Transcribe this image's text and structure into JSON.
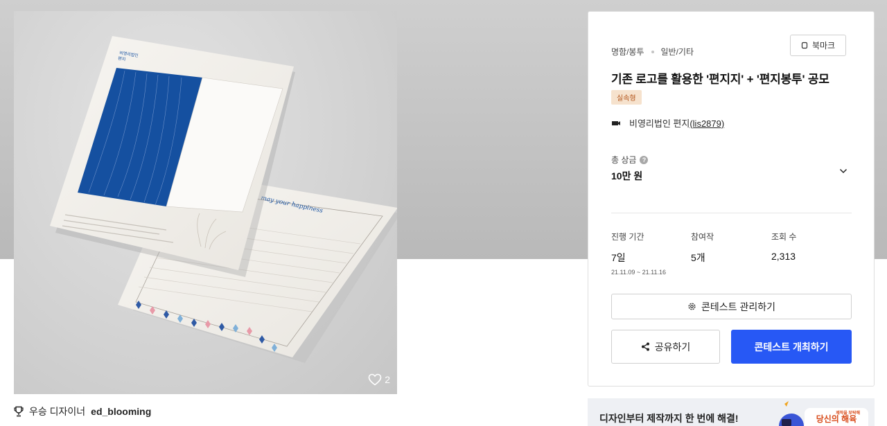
{
  "hero": {
    "like_count": "2",
    "letter_top_lines": [
      "비영리법인",
      "편지"
    ],
    "letter_script": "may your happiness"
  },
  "winner": {
    "prefix": "우승 디자이너",
    "name": "ed_blooming"
  },
  "panel": {
    "category": "명함/봉투",
    "subcategory": "일반/기타",
    "bookmark_label": "북마크",
    "title": "기존 로고를 활용한 '편지지' + '편지봉투' 공모",
    "badge": "실속형",
    "org_name": "비영리법인 편지",
    "org_handle": "(lis2879)",
    "prize_label": "총 상금",
    "prize_value": "10만 원",
    "stats": [
      {
        "label": "진행 기간",
        "value": "7일",
        "sub": "21.11.09 ~ 21.11.16"
      },
      {
        "label": "참여작",
        "value": "5개"
      },
      {
        "label": "조회 수",
        "value": "2,313"
      }
    ],
    "manage_label": "콘테스트 관리하기",
    "share_label": "공유하기",
    "host_label": "콘테스트 개최하기"
  },
  "ad": {
    "text": "디자인부터 제작까지 한 번에 해결!",
    "logo_small": "제작을 부탁해",
    "logo_big": "당신의 해육"
  },
  "colors": {
    "primary": "#2758f5",
    "badge_bg": "#f6e2cd",
    "badge_text": "#b2541a",
    "letter_blue": "#1550a0"
  }
}
